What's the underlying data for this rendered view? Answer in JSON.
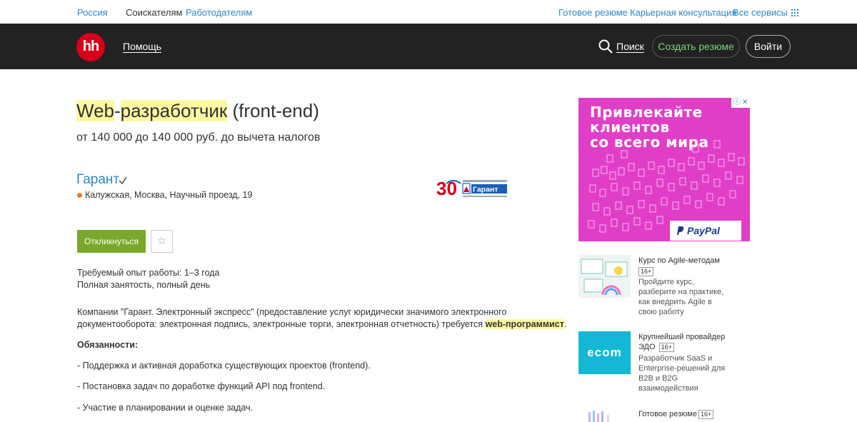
{
  "topbar": {
    "region": "Россия",
    "applicants": "Соискателям",
    "employers": "Работодателям",
    "ready_resume": "Готовое резюме",
    "career": "Карьерная консультация",
    "all_services": "Все сервисы"
  },
  "header": {
    "logo": "hh",
    "help": "Помощь",
    "search": "Поиск",
    "create_resume": "Создать резюме",
    "login": "Войти"
  },
  "vacancy": {
    "title_part1": "Web",
    "title_sep": "-",
    "title_part2": "разработчик",
    "title_rest": " (front-end)",
    "salary": "от 140 000 до 140 000 руб. до вычета налогов",
    "company": "Гарант",
    "address": "Калужская, Москва, Научный проезд, 19",
    "respond": "Откликнуться",
    "experience": "Требуемый опыт работы: 1–3 года",
    "employment": "Полная занятость, полный день",
    "desc_line1": "Компании \"Гарант. Электронный экспресс\" (предоставление услуг юридически значимого электронного",
    "desc_line2": "документооборота: электронная подпись, электронные торги, электронная отчетность) требуется ",
    "desc_highlight": "web-программист",
    "desc_end": ".",
    "duties_title": "Обязанности:",
    "duty1": "- Поддержка и активная доработка существующих проектов (frontend).",
    "duty2": "- Постановка задач по доработке функций API под frontend.",
    "duty3": "- Участие в планировании и оценке задач."
  },
  "ad": {
    "line1": "Привлекайте",
    "line2": "клиентов",
    "line3": "со всего мира",
    "brand": "PayPal",
    "color": "#e13ec8"
  },
  "side": {
    "item1_title": "Курс по Agile-методам",
    "item1_age": "16+",
    "item1_desc": [
      "Пройдите курс,",
      "разберите на практике,",
      "как внедрить Agile в",
      "свою работу"
    ],
    "item2_title1": "Крупнейший провайдер",
    "item2_title2": "ЭДО",
    "item2_age": "16+",
    "item2_logo": "ecom",
    "item2_desc": [
      "Разработчик SaaS и",
      "Enterprise-решений для",
      "B2B и B2G",
      "взаимодействия"
    ],
    "item3_title": "Готовое резюме",
    "item3_age": "16+"
  },
  "company_logo": {
    "number": "30",
    "brand": "Гарант"
  }
}
